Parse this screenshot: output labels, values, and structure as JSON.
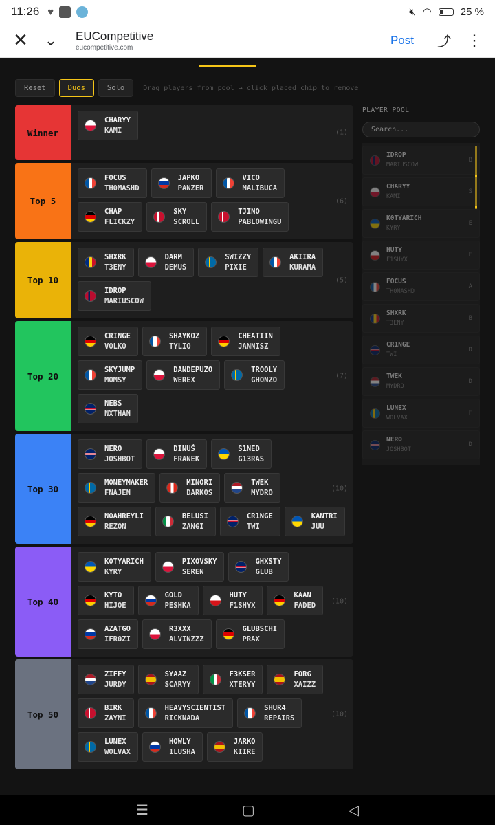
{
  "status": {
    "time": "11:26",
    "battery": "25 %"
  },
  "browser": {
    "title": "EUCompetitive",
    "url": "eucompetitive.com",
    "post_label": "Post"
  },
  "toolbar": {
    "reset": "Reset",
    "duos": "Duos",
    "solo": "Solo",
    "hint": "Drag players from pool → click placed chip to remove"
  },
  "tiers": [
    {
      "label": "Winner",
      "color": "#e63535",
      "count": "(1)",
      "players": [
        {
          "n1": "CHARYY",
          "n2": "KAMI",
          "flag": "pl"
        }
      ]
    },
    {
      "label": "Top 5",
      "color": "#f97316",
      "count": "(6)",
      "players": [
        {
          "n1": "FOCUS",
          "n2": "TH0MASHD",
          "flag": "fr"
        },
        {
          "n1": "JAPKO",
          "n2": "PANZER",
          "flag": "ru"
        },
        {
          "n1": "VICO",
          "n2": "MALIBUCA",
          "flag": "fr"
        },
        {
          "n1": "CHAP",
          "n2": "FLICKZY",
          "flag": "de"
        },
        {
          "n1": "SKY",
          "n2": "SCROLL",
          "flag": "dk"
        },
        {
          "n1": "TJINO",
          "n2": "PABLOWINGU",
          "flag": "dk"
        }
      ]
    },
    {
      "label": "Top 10",
      "color": "#eab308",
      "count": "(5)",
      "players": [
        {
          "n1": "SHXRK",
          "n2": "T3ENY",
          "flag": "ro"
        },
        {
          "n1": "DARM",
          "n2": "DEMUŚ",
          "flag": "pl"
        },
        {
          "n1": "SWIZZY",
          "n2": "PIXIE",
          "flag": "se"
        },
        {
          "n1": "AKIIRA",
          "n2": "KURAMA",
          "flag": "fr"
        },
        {
          "n1": "IDROP",
          "n2": "MARIUSCOW",
          "flag": "no"
        }
      ]
    },
    {
      "label": "Top 20",
      "color": "#22c55e",
      "count": "(7)",
      "players": [
        {
          "n1": "CRINGE",
          "n2": "VOLKO",
          "flag": "de"
        },
        {
          "n1": "SHAYKOZ",
          "n2": "TYLIO",
          "flag": "fr"
        },
        {
          "n1": "CHEATIIN",
          "n2": "JANNISZ",
          "flag": "de"
        },
        {
          "n1": "SKYJUMP",
          "n2": "MOMSY",
          "flag": "fr"
        },
        {
          "n1": "DANDEPUZO",
          "n2": "WEREX",
          "flag": "pl"
        },
        {
          "n1": "TROOLY",
          "n2": "GHONZO",
          "flag": "se"
        },
        {
          "n1": "NEBS",
          "n2": "NXTHAN",
          "flag": "gb"
        }
      ]
    },
    {
      "label": "Top 30",
      "color": "#3b82f6",
      "count": "(10)",
      "players": [
        {
          "n1": "NERO",
          "n2": "JOSHBOT",
          "flag": "gb"
        },
        {
          "n1": "DINUŚ",
          "n2": "FRANEK",
          "flag": "pl"
        },
        {
          "n1": "S1NED",
          "n2": "G13RAS",
          "flag": "ua"
        },
        {
          "n1": "MONEYMAKER",
          "n2": "FNAJEN",
          "flag": "se"
        },
        {
          "n1": "MINORI",
          "n2": "DARKOS",
          "flag": "ch"
        },
        {
          "n1": "TWEK",
          "n2": "MYDRO",
          "flag": "nl"
        },
        {
          "n1": "NOAHREYLI",
          "n2": "REZON",
          "flag": "de"
        },
        {
          "n1": "BELUSI",
          "n2": "ZANGI",
          "flag": "it"
        },
        {
          "n1": "CR1NGE",
          "n2": "TWI",
          "flag": "gb"
        },
        {
          "n1": "KANTRI",
          "n2": "JUU",
          "flag": "ua"
        }
      ]
    },
    {
      "label": "Top 40",
      "color": "#8b5cf6",
      "count": "(10)",
      "players": [
        {
          "n1": "K0TYARICH",
          "n2": "KYRY",
          "flag": "ua"
        },
        {
          "n1": "PIXOVSKY",
          "n2": "SEREN",
          "flag": "pl"
        },
        {
          "n1": "GHXSTY",
          "n2": "GLUB",
          "flag": "gb"
        },
        {
          "n1": "KYTO",
          "n2": "HIJOE",
          "flag": "de"
        },
        {
          "n1": "GOLD",
          "n2": "PESHKA",
          "flag": "ru"
        },
        {
          "n1": "HUTY",
          "n2": "F1SHYX",
          "flag": "cz"
        },
        {
          "n1": "KAAN",
          "n2": "FADED",
          "flag": "de"
        },
        {
          "n1": "AZATGO",
          "n2": "IFR0ZI",
          "flag": "ru"
        },
        {
          "n1": "R3XXX",
          "n2": "ALVINZZZ",
          "flag": "pl"
        },
        {
          "n1": "GLUBSCHI",
          "n2": "PRAX",
          "flag": "de"
        }
      ]
    },
    {
      "label": "Top 50",
      "color": "#6b7280",
      "count": "(10)",
      "players": [
        {
          "n1": "ZIFFY",
          "n2": "JURDY",
          "flag": "nl"
        },
        {
          "n1": "SYAAZ",
          "n2": "SCARYY",
          "flag": "es"
        },
        {
          "n1": "F3KSER",
          "n2": "XTERYY",
          "flag": "it"
        },
        {
          "n1": "FORG",
          "n2": "XAIZZ",
          "flag": "es"
        },
        {
          "n1": "BIRK",
          "n2": "ZAYNI",
          "flag": "dk"
        },
        {
          "n1": "HEAVYSCIENTIST",
          "n2": "RICKNADA",
          "flag": "fr"
        },
        {
          "n1": "SHUR4",
          "n2": "REPAIRS",
          "flag": "fr"
        },
        {
          "n1": "LUNEX",
          "n2": "WOLVAX",
          "flag": "se"
        },
        {
          "n1": "HOWLY",
          "n2": "1LUSHA",
          "flag": "ru"
        },
        {
          "n1": "JARKO",
          "n2": "KIIRE",
          "flag": "es"
        }
      ]
    }
  ],
  "pool": {
    "title": "PLAYER POOL",
    "search_placeholder": "Search...",
    "players": [
      {
        "n1": "IDROP",
        "n2": "MARIUSCOW",
        "tag": "B",
        "flag": "no"
      },
      {
        "n1": "CHARYY",
        "n2": "KAMI",
        "tag": "S",
        "flag": "pl"
      },
      {
        "n1": "K0TYARICH",
        "n2": "KYRY",
        "tag": "E",
        "flag": "ua"
      },
      {
        "n1": "HUTY",
        "n2": "F1SHYX",
        "tag": "E",
        "flag": "cz"
      },
      {
        "n1": "FOCUS",
        "n2": "TH0MASHD",
        "tag": "A",
        "flag": "fr"
      },
      {
        "n1": "SHXRK",
        "n2": "T3ENY",
        "tag": "B",
        "flag": "ro"
      },
      {
        "n1": "CR1NGE",
        "n2": "TWI",
        "tag": "D",
        "flag": "gb"
      },
      {
        "n1": "TWEK",
        "n2": "MYDRO",
        "tag": "D",
        "flag": "nl"
      },
      {
        "n1": "LUNEX",
        "n2": "WOLVAX",
        "tag": "F",
        "flag": "se"
      },
      {
        "n1": "NERO",
        "n2": "JOSHBOT",
        "tag": "D",
        "flag": "gb"
      }
    ]
  },
  "flags": {
    "pl": "linear-gradient(#ffffff 50%, #dc143c 50%)",
    "fr": "linear-gradient(90deg, #0055a4 33%, #ffffff 33% 66%, #ef4135 66%)",
    "ru": "linear-gradient(#ffffff 33%, #0039a6 33% 66%, #d52b1e 66%)",
    "de": "linear-gradient(#000000 33%, #dd0000 33% 66%, #ffce00 66%)",
    "dk": "linear-gradient(90deg, #c8102e 32%, #ffffff 32% 46%, #c8102e 46%)",
    "ro": "linear-gradient(90deg, #002b7f 33%, #fcd116 33% 66%, #ce1126 66%)",
    "se": "linear-gradient(90deg, #006aa7 32%, #fecc00 32% 48%, #006aa7 48%)",
    "no": "linear-gradient(90deg, #ba0c2f 30%, #00205b 30% 48%, #ba0c2f 48%)",
    "gb": "linear-gradient(#012169 40%, #ffffff 40% 44%, #c8102e 44% 56%, #ffffff 56% 60%, #012169 60%)",
    "ua": "linear-gradient(#0057b7 50%, #ffd700 50%)",
    "ch": "linear-gradient(90deg, #da291c 38%, #ffffff 38% 62%, #da291c 62%)",
    "nl": "linear-gradient(#ae1c28 33%, #ffffff 33% 66%, #21468b 66%)",
    "it": "linear-gradient(90deg, #009246 33%, #ffffff 33% 66%, #ce2b37 66%)",
    "cz": "linear-gradient(#ffffff 50%, #d7141a 50%)",
    "es": "linear-gradient(#aa151b 25%, #f1bf00 25% 75%, #aa151b 75%)"
  }
}
